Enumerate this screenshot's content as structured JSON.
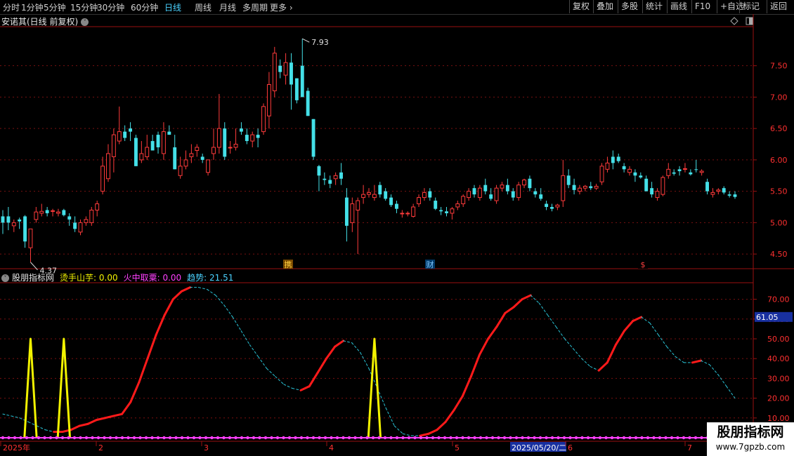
{
  "toolbar": {
    "periods": [
      "分时",
      "1分钟",
      "5分钟",
      "15分钟",
      "30分钟",
      "60分钟",
      "日线",
      "周线",
      "月线",
      "多周期",
      "更多"
    ],
    "active_period": "日线",
    "right_buttons": [
      "复权",
      "叠加",
      "多股",
      "统计",
      "画线",
      "F10",
      "+自选",
      "标记",
      "返回"
    ]
  },
  "price_panel": {
    "stock_title": "安诺其(日线 前复权)",
    "y_ticks": [
      "7.50",
      "7.00",
      "6.50",
      "6.00",
      "5.50",
      "5.00",
      "4.50"
    ],
    "high_label": "7.93",
    "low_label": "4.37",
    "event_marks": [
      "携",
      "财",
      "$"
    ]
  },
  "indicator_panel": {
    "name": "股朋指标网",
    "items": [
      {
        "label": "烫手山芋:",
        "value": "0.00",
        "color": "#f2f200"
      },
      {
        "label": "火中取粟:",
        "value": "0.00",
        "color": "#ff40ff"
      },
      {
        "label": "趋势:",
        "value": "21.51",
        "color": "#4ad2ff"
      }
    ],
    "y_ticks": [
      "70.00",
      "60.00",
      "50.00",
      "40.00",
      "30.00",
      "20.00",
      "10.00"
    ],
    "current_value_badge": "61.05"
  },
  "time_axis": {
    "labels": [
      "2025年",
      "2",
      "3",
      "4",
      "5",
      "2025/05/20/二",
      "6",
      "7"
    ]
  },
  "watermark": {
    "line1": "股朋指标网",
    "line2": "www.7gpzb.com"
  },
  "colors": {
    "up": "#ff3b3b",
    "down": "#44e0e8",
    "grid": "#7a1010",
    "axis_text": "#ff3030",
    "trend_rise": "#ff1a1a",
    "trend_fall": "#29c3d6",
    "spike": "#f2f200",
    "baseline": "#ff40ff"
  },
  "chart_data": [
    {
      "type": "candlestick",
      "title": "安诺其(日线 前复权)",
      "ylim": [
        4.3,
        8.1
      ],
      "annotations": {
        "high": 7.93,
        "low": 4.37
      },
      "candles": [
        [
          5.1,
          5.2,
          4.82,
          5.0
        ],
        [
          5.1,
          5.25,
          4.88,
          5.0
        ],
        [
          4.95,
          5.05,
          4.85,
          5.0
        ],
        [
          5.05,
          5.08,
          4.9,
          5.02
        ],
        [
          5.1,
          5.12,
          4.6,
          4.7
        ],
        [
          4.6,
          4.9,
          4.37,
          4.9
        ],
        [
          5.05,
          5.25,
          5.0,
          5.17
        ],
        [
          5.15,
          5.3,
          5.1,
          5.18
        ],
        [
          5.2,
          5.25,
          5.1,
          5.15
        ],
        [
          5.18,
          5.22,
          5.1,
          5.19
        ],
        [
          5.15,
          5.22,
          5.1,
          5.17
        ],
        [
          5.2,
          5.22,
          5.1,
          5.12
        ],
        [
          5.1,
          5.15,
          4.95,
          5.05
        ],
        [
          5.0,
          5.1,
          4.85,
          4.9
        ],
        [
          4.85,
          5.05,
          4.8,
          5.0
        ],
        [
          5.0,
          5.1,
          4.95,
          5.05
        ],
        [
          5.0,
          5.25,
          4.95,
          5.2
        ],
        [
          5.2,
          5.35,
          5.1,
          5.3
        ],
        [
          5.5,
          6.05,
          5.45,
          5.9
        ],
        [
          5.7,
          6.25,
          5.65,
          6.1
        ],
        [
          6.05,
          6.5,
          5.8,
          6.4
        ],
        [
          6.3,
          6.85,
          6.25,
          6.45
        ],
        [
          6.45,
          6.55,
          6.3,
          6.35
        ],
        [
          6.5,
          6.6,
          6.3,
          6.45
        ],
        [
          6.35,
          6.4,
          5.9,
          5.9
        ],
        [
          6.0,
          6.3,
          5.95,
          6.1
        ],
        [
          6.05,
          6.4,
          6.0,
          6.2
        ],
        [
          6.3,
          6.4,
          6.15,
          6.15
        ],
        [
          6.4,
          6.45,
          6.1,
          6.2
        ],
        [
          6.1,
          6.6,
          6.0,
          6.45
        ],
        [
          6.45,
          6.55,
          6.4,
          6.4
        ],
        [
          6.2,
          6.4,
          5.85,
          5.85
        ],
        [
          5.75,
          6.05,
          5.7,
          5.9
        ],
        [
          5.9,
          6.15,
          5.85,
          6.0
        ],
        [
          6.05,
          6.25,
          5.95,
          6.1
        ],
        [
          6.15,
          6.25,
          6.05,
          6.2
        ],
        [
          6.05,
          6.1,
          5.95,
          6.0
        ],
        [
          5.8,
          6.0,
          5.75,
          6.0
        ],
        [
          6.1,
          6.5,
          6.0,
          6.2
        ],
        [
          6.2,
          7.05,
          6.1,
          6.5
        ],
        [
          6.5,
          6.6,
          6.0,
          6.05
        ],
        [
          6.2,
          6.3,
          6.1,
          6.2
        ],
        [
          6.2,
          6.5,
          6.15,
          6.25
        ],
        [
          6.5,
          6.6,
          6.4,
          6.45
        ],
        [
          6.4,
          6.5,
          6.25,
          6.3
        ],
        [
          6.3,
          6.45,
          6.2,
          6.4
        ],
        [
          6.4,
          6.5,
          6.2,
          6.35
        ],
        [
          6.45,
          6.9,
          6.4,
          6.85
        ],
        [
          6.7,
          7.4,
          6.5,
          7.2
        ],
        [
          7.1,
          7.8,
          7.0,
          7.7
        ],
        [
          7.5,
          7.6,
          7.3,
          7.4
        ],
        [
          7.35,
          7.7,
          7.2,
          7.55
        ],
        [
          7.55,
          7.7,
          6.8,
          7.2
        ],
        [
          7.3,
          7.3,
          6.9,
          6.95
        ],
        [
          7.5,
          7.93,
          7.3,
          7.0
        ],
        [
          7.1,
          7.15,
          6.7,
          6.7
        ],
        [
          6.65,
          6.65,
          6.0,
          6.05
        ],
        [
          5.9,
          5.92,
          5.5,
          5.75
        ],
        [
          5.7,
          5.8,
          5.6,
          5.68
        ],
        [
          5.68,
          5.75,
          5.55,
          5.62
        ],
        [
          5.7,
          5.8,
          5.6,
          5.75
        ],
        [
          5.8,
          5.95,
          5.6,
          5.7
        ],
        [
          5.4,
          5.55,
          4.7,
          4.95
        ],
        [
          5.0,
          5.4,
          4.85,
          5.3
        ],
        [
          5.2,
          5.4,
          4.5,
          5.35
        ],
        [
          5.4,
          5.6,
          5.3,
          5.45
        ],
        [
          5.45,
          5.55,
          5.4,
          5.48
        ],
        [
          5.4,
          5.6,
          5.35,
          5.45
        ],
        [
          5.6,
          5.65,
          5.4,
          5.45
        ],
        [
          5.5,
          5.55,
          5.35,
          5.38
        ],
        [
          5.4,
          5.45,
          5.25,
          5.28
        ],
        [
          5.3,
          5.35,
          5.15,
          5.22
        ],
        [
          5.15,
          5.2,
          5.08,
          5.15
        ],
        [
          5.15,
          5.18,
          5.1,
          5.15
        ],
        [
          5.1,
          5.3,
          5.08,
          5.25
        ],
        [
          5.3,
          5.45,
          5.25,
          5.4
        ],
        [
          5.4,
          5.55,
          5.35,
          5.48
        ],
        [
          5.5,
          5.55,
          5.35,
          5.4
        ],
        [
          5.35,
          5.4,
          5.2,
          5.22
        ],
        [
          5.2,
          5.25,
          5.12,
          5.18
        ],
        [
          5.18,
          5.25,
          5.1,
          5.15
        ],
        [
          5.15,
          5.25,
          5.05,
          5.22
        ],
        [
          5.25,
          5.35,
          5.2,
          5.3
        ],
        [
          5.3,
          5.45,
          5.25,
          5.42
        ],
        [
          5.4,
          5.55,
          5.35,
          5.5
        ],
        [
          5.55,
          5.6,
          5.4,
          5.45
        ],
        [
          5.4,
          5.6,
          5.35,
          5.55
        ],
        [
          5.6,
          5.7,
          5.45,
          5.5
        ],
        [
          5.45,
          5.55,
          5.35,
          5.38
        ],
        [
          5.35,
          5.6,
          5.3,
          5.55
        ],
        [
          5.55,
          5.65,
          5.5,
          5.6
        ],
        [
          5.6,
          5.7,
          5.45,
          5.5
        ],
        [
          5.5,
          5.55,
          5.35,
          5.4
        ],
        [
          5.4,
          5.65,
          5.35,
          5.6
        ],
        [
          5.6,
          5.7,
          5.55,
          5.68
        ],
        [
          5.7,
          5.75,
          5.5,
          5.55
        ],
        [
          5.5,
          5.55,
          5.4,
          5.45
        ],
        [
          5.45,
          5.55,
          5.35,
          5.38
        ],
        [
          5.3,
          5.35,
          5.2,
          5.25
        ],
        [
          5.25,
          5.3,
          5.18,
          5.22
        ],
        [
          5.25,
          5.3,
          5.2,
          5.28
        ],
        [
          5.35,
          6.0,
          5.25,
          5.75
        ],
        [
          5.75,
          5.85,
          5.55,
          5.6
        ],
        [
          5.6,
          5.7,
          5.45,
          5.52
        ],
        [
          5.5,
          5.6,
          5.45,
          5.55
        ],
        [
          5.55,
          5.6,
          5.5,
          5.58
        ],
        [
          5.58,
          5.65,
          5.52,
          5.55
        ],
        [
          5.55,
          5.62,
          5.52,
          5.58
        ],
        [
          5.65,
          5.95,
          5.6,
          5.9
        ],
        [
          5.85,
          6.05,
          5.8,
          5.95
        ],
        [
          6.05,
          6.15,
          5.85,
          5.95
        ],
        [
          6.05,
          6.1,
          5.95,
          5.98
        ],
        [
          5.9,
          5.95,
          5.8,
          5.85
        ],
        [
          5.8,
          5.9,
          5.75,
          5.85
        ],
        [
          5.8,
          5.85,
          5.65,
          5.75
        ],
        [
          5.75,
          5.8,
          5.7,
          5.72
        ],
        [
          5.7,
          5.75,
          5.5,
          5.5
        ],
        [
          5.55,
          5.65,
          5.4,
          5.45
        ],
        [
          5.4,
          5.55,
          5.35,
          5.5
        ],
        [
          5.45,
          5.75,
          5.42,
          5.72
        ],
        [
          5.75,
          5.95,
          5.7,
          5.85
        ],
        [
          5.8,
          5.85,
          5.75,
          5.78
        ],
        [
          5.85,
          5.9,
          5.75,
          5.82
        ],
        [
          5.85,
          5.95,
          5.8,
          5.86
        ],
        [
          5.8,
          5.85,
          5.75,
          5.77
        ],
        [
          5.85,
          6.0,
          5.8,
          5.84
        ],
        [
          5.8,
          5.85,
          5.75,
          5.82
        ],
        [
          5.65,
          5.7,
          5.45,
          5.5
        ],
        [
          5.45,
          5.55,
          5.4,
          5.48
        ],
        [
          5.5,
          5.55,
          5.45,
          5.52
        ],
        [
          5.55,
          5.58,
          5.45,
          5.48
        ],
        [
          5.45,
          5.5,
          5.4,
          5.43
        ],
        [
          5.45,
          5.5,
          5.38,
          5.41
        ]
      ]
    },
    {
      "type": "line",
      "title": "股朋指标网",
      "ylim": [
        0,
        78
      ],
      "series": [
        {
          "name": "趋势",
          "values": [
            12,
            11,
            10,
            8,
            6,
            4,
            3,
            3,
            4,
            6,
            7,
            9,
            10,
            11,
            12,
            18,
            28,
            40,
            52,
            62,
            70,
            74,
            76,
            76,
            75,
            72,
            67,
            61,
            54,
            47,
            41,
            35,
            31,
            27,
            25,
            24,
            26,
            33,
            40,
            46,
            49,
            48,
            43,
            35,
            25,
            15,
            6,
            2,
            1,
            1,
            2,
            4,
            8,
            14,
            21,
            31,
            42,
            50,
            56,
            63,
            66,
            70,
            72,
            68,
            62,
            56,
            50,
            45,
            40,
            36,
            34,
            38,
            47,
            54,
            59,
            61,
            58,
            52,
            46,
            41,
            38,
            38,
            39,
            37,
            32,
            26,
            20
          ],
          "rising_flags": [
            0,
            0,
            0,
            0,
            0,
            0,
            0,
            1,
            1,
            1,
            1,
            1,
            1,
            1,
            1,
            1,
            1,
            1,
            1,
            1,
            1,
            1,
            1,
            0,
            0,
            0,
            0,
            0,
            0,
            0,
            0,
            0,
            0,
            0,
            0,
            0,
            1,
            1,
            1,
            1,
            1,
            0,
            0,
            0,
            0,
            0,
            0,
            0,
            0,
            0,
            1,
            1,
            1,
            1,
            1,
            1,
            1,
            1,
            1,
            1,
            1,
            1,
            1,
            0,
            0,
            0,
            0,
            0,
            0,
            0,
            0,
            1,
            1,
            1,
            1,
            1,
            0,
            0,
            0,
            0,
            0,
            0,
            1,
            0,
            0,
            0,
            0
          ]
        },
        {
          "name": "烫手山芋",
          "spikes_at_bars": [
            5,
            11,
            67
          ],
          "spike_height": 50,
          "last_value": 0
        },
        {
          "name": "火中取粟",
          "last_value": 0
        }
      ]
    }
  ]
}
